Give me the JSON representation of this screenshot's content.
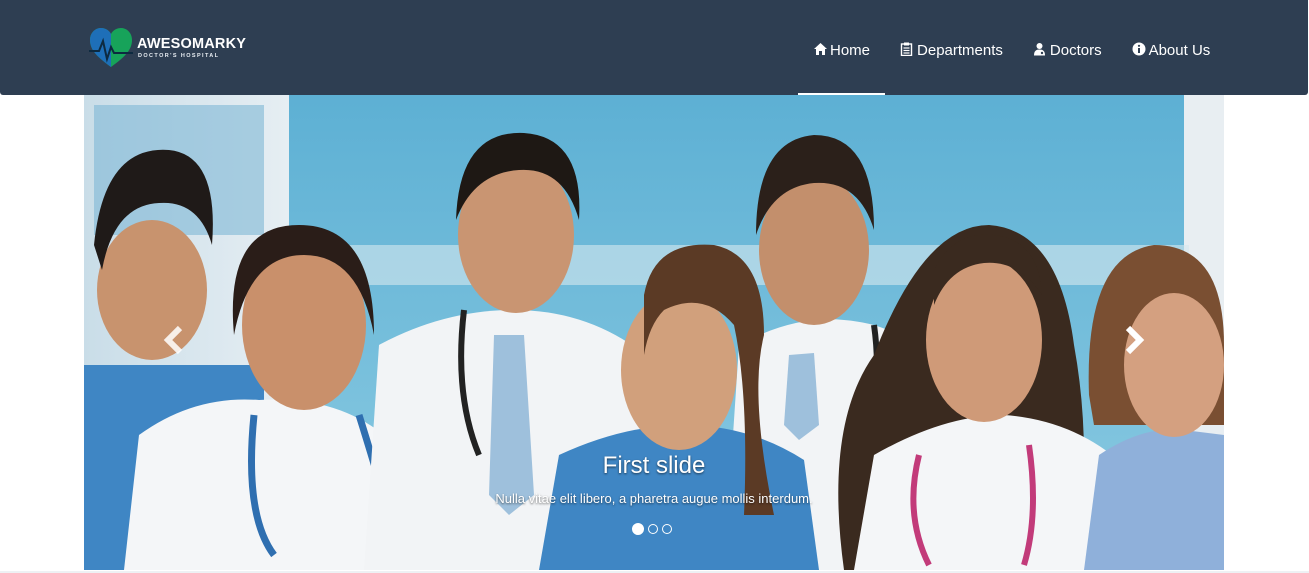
{
  "brand": {
    "name": "AWESOMARKY",
    "tagline": "DOCTOR'S HOSPITAL",
    "logo_icon": "heart-pulse-icon",
    "logo_colors": [
      "#1e6fb8",
      "#17a35a"
    ]
  },
  "nav": {
    "items": [
      {
        "label": "Home",
        "icon": "home-icon",
        "active": true
      },
      {
        "label": "Departments",
        "icon": "clipboard-icon",
        "active": false
      },
      {
        "label": "Doctors",
        "icon": "user-md-icon",
        "active": false
      },
      {
        "label": "About Us",
        "icon": "info-circle-icon",
        "active": false
      }
    ]
  },
  "carousel": {
    "slide": {
      "title": "First slide",
      "text": "Nulla vitae elit libero, a pharetra augue mollis interdum."
    },
    "prev_icon": "chevron-left-icon",
    "next_icon": "chevron-right-icon",
    "slide_count": 3,
    "active_index": 0
  },
  "colors": {
    "navbar_bg": "#2e3e52",
    "nav_text": "#ffffff",
    "scrub_blue": "#3f86c4",
    "coat_white": "#f4f6f8"
  }
}
